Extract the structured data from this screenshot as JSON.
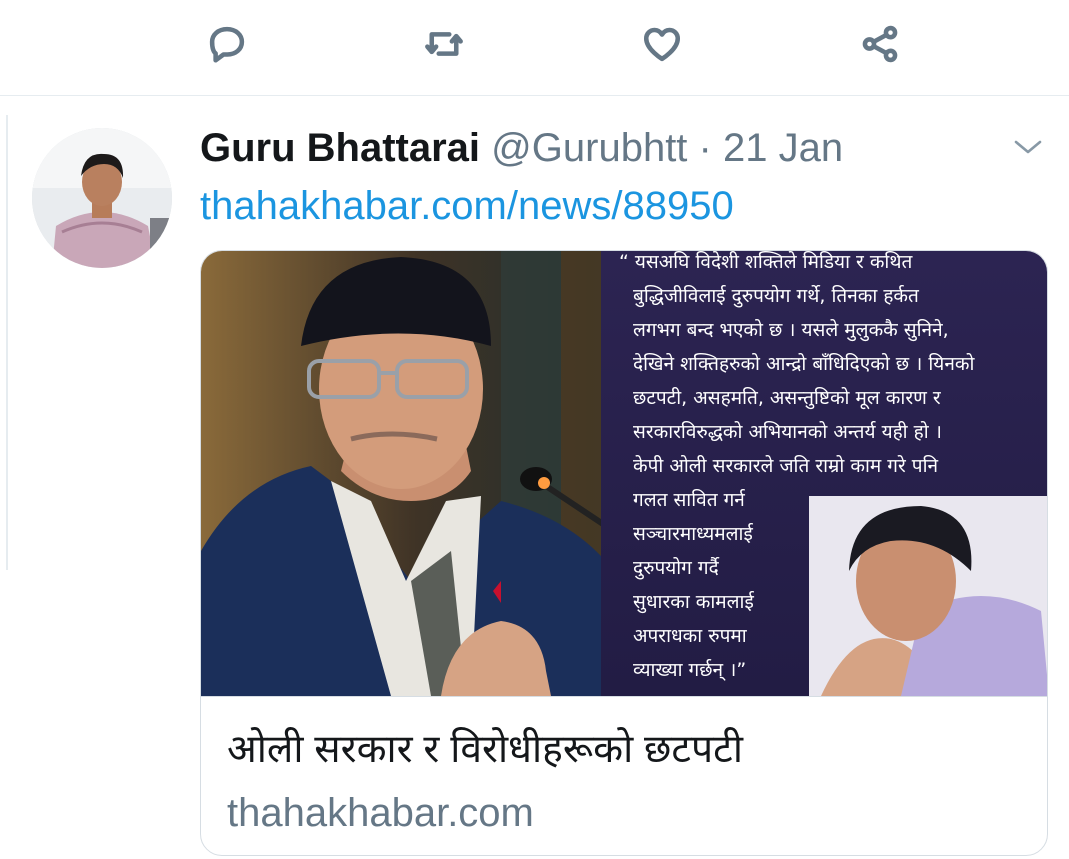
{
  "actions": {
    "reply_icon": "speech-bubble",
    "retweet_icon": "retweet-arrows",
    "like_icon": "heart",
    "share_icon": "share-nodes"
  },
  "tweet": {
    "display_name": "Guru Bhattarai",
    "handle": "@Gurubhtt",
    "separator": "·",
    "date": "21 Jan",
    "link_text": "thahakhabar.com/news/88950",
    "caret_icon": "chevron-down"
  },
  "card": {
    "title": "ओली सरकार र विरोधीहरूको छटपटी",
    "domain": "thahakhabar.com",
    "quote_lines": [
      "“ यसअघि विदेशी शक्तिले मिडिया र कथित",
      "बुद्धिजीविलाई दुरुपयोग गर्थे, तिनका हर्कत",
      "लगभग बन्द भएको छ । यसले मुलुककै सुनिने,",
      "देखिने शक्तिहरुको आन्द्रो बाँधिदिएको छ । यिनको",
      "छटपटी, असहमति, असन्तुष्टिको मूल कारण र",
      "सरकारविरुद्धको अभियानको अन्तर्य यही हो ।",
      "केपी ओली सरकारले जति राम्रो काम गरे पनि",
      "गलत सावित गर्न",
      "सञ्चारमाध्यमलाई",
      "दुरुपयोग गर्दै",
      "सुधारका कामलाई",
      "अपराधका रुपमा",
      "व्याख्या गर्छन् ।”"
    ]
  },
  "colors": {
    "link": "#1b95e0",
    "muted": "#657786",
    "text": "#14171a",
    "quote_panel": "#2c2452"
  }
}
